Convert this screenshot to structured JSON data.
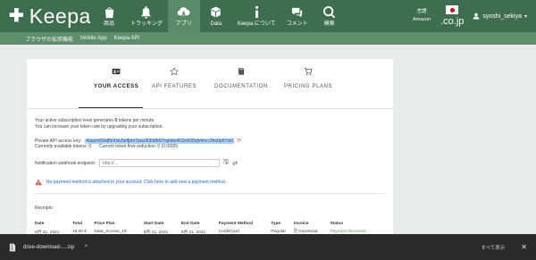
{
  "nav": {
    "logo": "Keepa",
    "items": [
      {
        "label": "商品",
        "icon": "bag-icon"
      },
      {
        "label": "トラッキング",
        "icon": "bell-icon"
      },
      {
        "label": "アプリ",
        "icon": "cloud-download-icon"
      },
      {
        "label": "Data",
        "icon": "cube-icon"
      },
      {
        "label": "Keepa について",
        "icon": "info-icon"
      },
      {
        "label": "コメント",
        "icon": "chat-icon"
      },
      {
        "label": "検索",
        "icon": "search-icon"
      }
    ],
    "locale_top": "言語",
    "locale_bottom": "Amazon",
    "domain": ".co.jp",
    "user": "syoshi_sekiya"
  },
  "subnav": {
    "items": [
      "ブラウザの拡張機能",
      "Mobile App",
      "Keepa API"
    ]
  },
  "tabs": [
    {
      "label": "YOUR ACCESS",
      "icon": "id-card-icon"
    },
    {
      "label": "API FEATURES",
      "icon": "star-icon"
    },
    {
      "label": "DOCUMENTATION",
      "icon": "book-icon"
    },
    {
      "label": "PRICING PLANS",
      "icon": "cart-icon"
    }
  ],
  "access": {
    "line1_pre": "Your active subscription level generates",
    "line1_num": "0",
    "line1_post": "tokens per minute.",
    "line2": "You can increase your token rate by upgrading your subscription.",
    "api_key_label": "Private API access key:",
    "api_key": "4uqsm59a8hnhsu9pffpm7pau906d8r67rqeido463v6t28qlvfmcc3hu0ph7ni0",
    "tokens_label": "Currently available tokens:",
    "tokens_value": "0",
    "reduction_label": "Current token flow reduction:",
    "reduction_value": "0 (0.0000)",
    "webhook_label": "Notification webhook endpoint:",
    "webhook_placeholder": "http://...",
    "warning": "No payment method is attached to your account. Click here to add new a payment method."
  },
  "receipts": {
    "label": "Receipts:",
    "headers": [
      "Date",
      "Total",
      "Price Plan",
      "Start Date",
      "End Date",
      "Payment Method",
      "Type",
      "Invoice",
      "Status"
    ],
    "rows": [
      [
        "8月 21, 2021",
        "19,00 €",
        "Data_Access_19",
        "8月 21, 2021",
        "9月 21, 2021",
        "CreditCard",
        "Regular",
        "Download",
        "Payment Received"
      ],
      [
        "7月 21, 2021",
        "19,00 €",
        "Data_Access_19",
        "7月 21, 2021",
        "8月 21, 2021",
        "CreditCard",
        "Regular",
        "Download",
        "Payment Received"
      ],
      [
        "6月 21, 2021",
        "19,00 €",
        "Data_Access_19",
        "6月 21, 2021",
        "7月 21, 2021",
        "CreditCard",
        "Regular",
        "Download",
        "Payment Received"
      ]
    ]
  },
  "downloads": {
    "file": "drive-download-....zip",
    "show_all": "すべて表示"
  }
}
